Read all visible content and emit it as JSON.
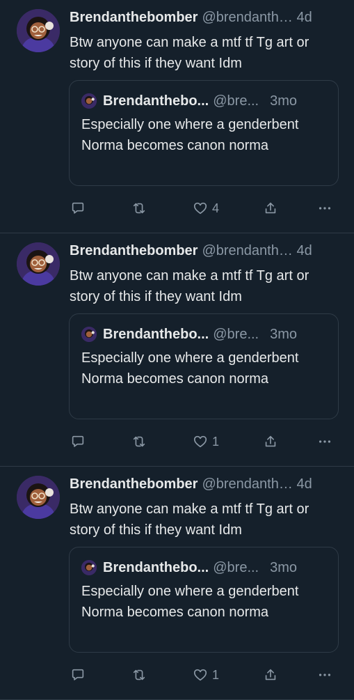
{
  "posts": [
    {
      "author_name": "Brendanthebomber",
      "author_handle": "@brendanthebomber",
      "time": "4d",
      "text": "Btw anyone can make a mtf tf Tg art or story of this if they want Idm",
      "quote": {
        "author_name": "Brendanthebo...",
        "author_handle": "@bre...",
        "time": "3mo",
        "text": "Especially one where a genderbent Norma becomes canon norma"
      },
      "like_count": "4"
    },
    {
      "author_name": "Brendanthebomber",
      "author_handle": "@brendanthebomber",
      "time": "4d",
      "text": "Btw anyone can make a mtf tf Tg art or story of this if they want Idm",
      "quote": {
        "author_name": "Brendanthebo...",
        "author_handle": "@bre...",
        "time": "3mo",
        "text": "Especially one where a genderbent Norma becomes canon norma"
      },
      "like_count": "1"
    },
    {
      "author_name": "Brendanthebomber",
      "author_handle": "@brendanthebomber",
      "time": "4d",
      "text": "Btw anyone can make a mtf tf Tg art or story of this if they want Idm",
      "quote": {
        "author_name": "Brendanthebo...",
        "author_handle": "@bre...",
        "time": "3mo",
        "text": "Especially one where a genderbent Norma becomes canon norma"
      },
      "like_count": "1"
    }
  ],
  "theme": {
    "background": "#15202b",
    "text": "#e7e9ea",
    "muted": "#8b98a5",
    "border": "#2f3b47"
  },
  "icons": [
    "reply-icon",
    "repost-icon",
    "like-icon",
    "share-icon",
    "more-icon"
  ]
}
